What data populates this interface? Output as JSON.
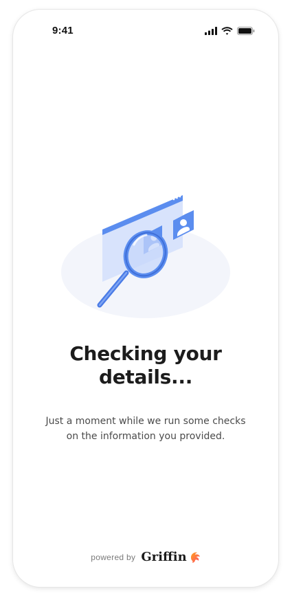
{
  "status_bar": {
    "time": "9:41",
    "icons": [
      "signal-icon",
      "wifi-icon",
      "battery-icon"
    ]
  },
  "illustration": {
    "icon": "magnifying-glass-id-card-illustration",
    "colors": {
      "primary": "#5b8def",
      "light": "#c7d7fb",
      "background_ellipse": "#f3f5fb"
    }
  },
  "main": {
    "title_line1": "Checking your",
    "title_line2": "details...",
    "subtitle_line1": "Just a moment while we run some checks",
    "subtitle_line2": "on the information you provided."
  },
  "footer": {
    "powered_by": "powered by",
    "brand": "Griffin",
    "brand_icon": "griffin-logo-icon",
    "brand_icon_colors": [
      "#ff4d6d",
      "#ff9f1c"
    ]
  }
}
